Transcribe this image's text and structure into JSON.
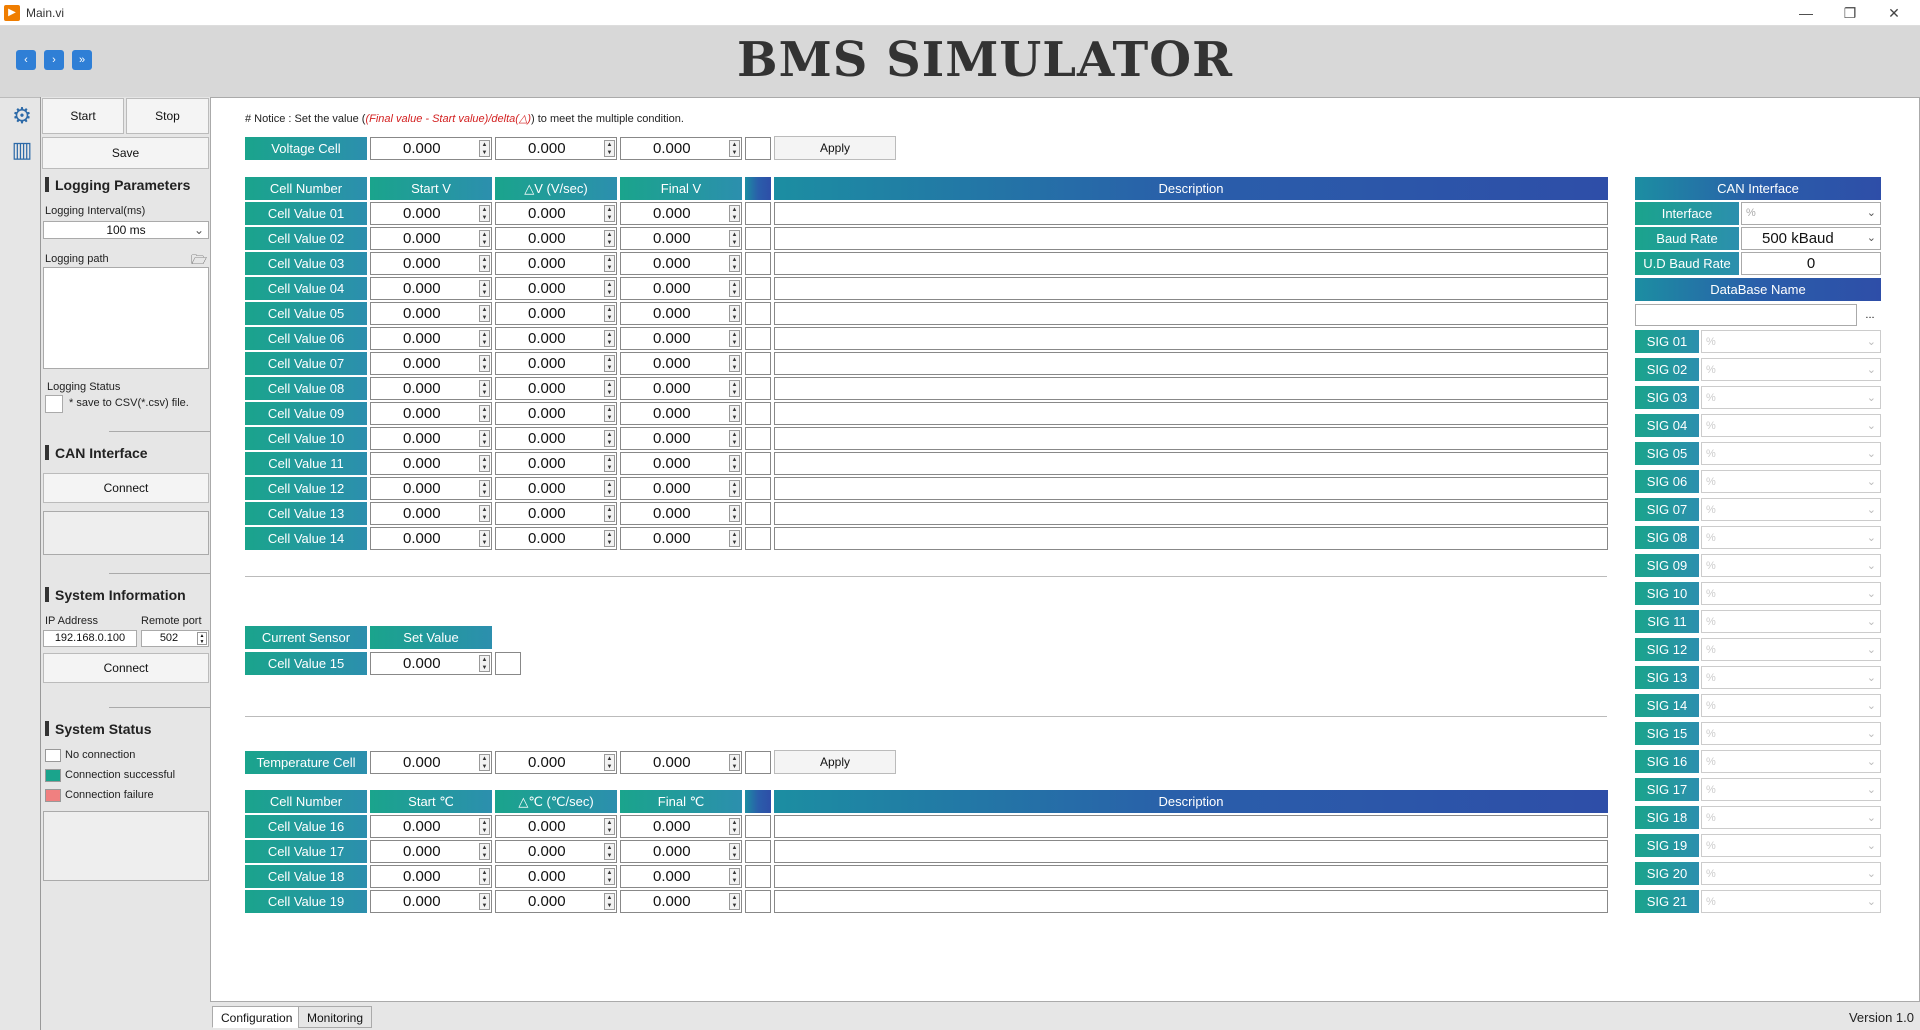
{
  "window": {
    "title": "Main.vi"
  },
  "app": {
    "title": "BMS SIMULATOR",
    "version": "Version  1.0"
  },
  "controls": {
    "start": "Start",
    "stop": "Stop",
    "save": "Save"
  },
  "logging": {
    "section": "Logging  Parameters",
    "interval_label": "Logging  Interval(ms)",
    "interval_value": "100 ms",
    "path_label": "Logging  path",
    "status_label": "Logging  Status",
    "csv_note": "*  save  to  CSV(*.csv)  file."
  },
  "can_left": {
    "section": "CAN  Interface",
    "connect": "Connect"
  },
  "sysinfo": {
    "section": "System  Information",
    "ip_label": "IP  Address",
    "ip_value": "192.168.0.100",
    "port_label": "Remote  port",
    "port_value": "502",
    "connect": "Connect"
  },
  "sysstatus": {
    "section": "System  Status",
    "items": [
      {
        "label": "No  connection",
        "color": "#ffffff"
      },
      {
        "label": "Connection  successful",
        "color": "#1aa48c"
      },
      {
        "label": "Connection  failure",
        "color": "#f08080"
      }
    ]
  },
  "notice": {
    "prefix": "#  Notice  :  Set  the  value  (",
    "formula": "(Final  value  -  Start  value)/delta(△)",
    "suffix": ")  to  meet  the  multiple  condition."
  },
  "voltage": {
    "label": "Voltage  Cell",
    "v1": "0.000",
    "v2": "0.000",
    "v3": "0.000",
    "apply": "Apply",
    "headers": [
      "Cell  Number",
      "Start  V",
      "△V  (V/sec)",
      "Final  V",
      "Description"
    ],
    "rows": [
      {
        "name": "Cell  Value  01",
        "start": "0.000",
        "delta": "0.000",
        "final": "0.000"
      },
      {
        "name": "Cell  Value  02",
        "start": "0.000",
        "delta": "0.000",
        "final": "0.000"
      },
      {
        "name": "Cell  Value  03",
        "start": "0.000",
        "delta": "0.000",
        "final": "0.000"
      },
      {
        "name": "Cell  Value  04",
        "start": "0.000",
        "delta": "0.000",
        "final": "0.000"
      },
      {
        "name": "Cell  Value  05",
        "start": "0.000",
        "delta": "0.000",
        "final": "0.000"
      },
      {
        "name": "Cell  Value  06",
        "start": "0.000",
        "delta": "0.000",
        "final": "0.000"
      },
      {
        "name": "Cell  Value  07",
        "start": "0.000",
        "delta": "0.000",
        "final": "0.000"
      },
      {
        "name": "Cell  Value  08",
        "start": "0.000",
        "delta": "0.000",
        "final": "0.000"
      },
      {
        "name": "Cell  Value  09",
        "start": "0.000",
        "delta": "0.000",
        "final": "0.000"
      },
      {
        "name": "Cell  Value  10",
        "start": "0.000",
        "delta": "0.000",
        "final": "0.000"
      },
      {
        "name": "Cell  Value  11",
        "start": "0.000",
        "delta": "0.000",
        "final": "0.000"
      },
      {
        "name": "Cell  Value  12",
        "start": "0.000",
        "delta": "0.000",
        "final": "0.000"
      },
      {
        "name": "Cell  Value  13",
        "start": "0.000",
        "delta": "0.000",
        "final": "0.000"
      },
      {
        "name": "Cell  Value  14",
        "start": "0.000",
        "delta": "0.000",
        "final": "0.000"
      }
    ]
  },
  "current": {
    "headers": [
      "Current  Sensor",
      "Set  Value"
    ],
    "name": "Cell  Value  15",
    "value": "0.000"
  },
  "temperature": {
    "label": "Temperature  Cell",
    "v1": "0.000",
    "v2": "0.000",
    "v3": "0.000",
    "apply": "Apply",
    "headers": [
      "Cell  Number",
      "Start  ℃",
      "△℃  (℃/sec)",
      "Final  ℃",
      "Description"
    ],
    "rows": [
      {
        "name": "Cell  Value  16",
        "start": "0.000",
        "delta": "0.000",
        "final": "0.000"
      },
      {
        "name": "Cell  Value  17",
        "start": "0.000",
        "delta": "0.000",
        "final": "0.000"
      },
      {
        "name": "Cell  Value  18",
        "start": "0.000",
        "delta": "0.000",
        "final": "0.000"
      },
      {
        "name": "Cell  Value  19",
        "start": "0.000",
        "delta": "0.000",
        "final": "0.000"
      }
    ]
  },
  "can_right": {
    "title": "CAN  Interface",
    "interface_label": "Interface",
    "interface_value": "%",
    "baud_label": "Baud  Rate",
    "baud_value": "500  kBaud",
    "ud_label": "U.D  Baud  Rate",
    "ud_value": "0",
    "db_label": "DataBase  Name",
    "browse": "...",
    "signals": [
      "SIG  01",
      "SIG  02",
      "SIG  03",
      "SIG  04",
      "SIG  05",
      "SIG  06",
      "SIG  07",
      "SIG  08",
      "SIG  09",
      "SIG  10",
      "SIG  11",
      "SIG  12",
      "SIG  13",
      "SIG  14",
      "SIG  15",
      "SIG  16",
      "SIG  17",
      "SIG  18",
      "SIG  19",
      "SIG  20",
      "SIG  21"
    ],
    "signal_value": "%"
  },
  "tabs": [
    "Configuration",
    "Monitoring"
  ]
}
